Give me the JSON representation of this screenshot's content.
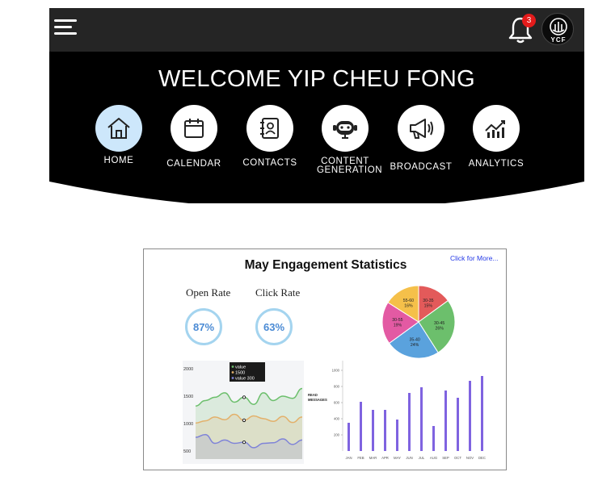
{
  "header": {
    "notification_count": "3",
    "logo_text": "YCF"
  },
  "hero": {
    "welcome": "WELCOME YIP CHEU FONG"
  },
  "nav": [
    {
      "label": "HOME",
      "icon": "home-icon",
      "active": true
    },
    {
      "label": "CALENDAR",
      "icon": "calendar-icon"
    },
    {
      "label": "CONTACTS",
      "icon": "contacts-icon"
    },
    {
      "label": "CONTENT GENERATION",
      "icon": "robot-icon"
    },
    {
      "label": "BROADCAST",
      "icon": "megaphone-icon"
    },
    {
      "label": "ANALYTICS",
      "icon": "analytics-icon"
    }
  ],
  "stats": {
    "title": "May Engagement Statistics",
    "link": "Click for More...",
    "open_rate_label": "Open Rate",
    "open_rate": "87%",
    "click_rate_label": "Click Rate",
    "click_rate": "63%"
  },
  "chart_data": [
    {
      "type": "pie",
      "slices": [
        {
          "label": "30-35",
          "value": 15,
          "display": "30-35\n15%",
          "color": "#e35a5a"
        },
        {
          "label": "30-45",
          "value": 26,
          "display": "30-45\n26%",
          "color": "#6cbf6c"
        },
        {
          "label": "35-40",
          "value": 24,
          "display": "35-40\n24%",
          "color": "#5aa2dd"
        },
        {
          "label": "30-55",
          "value": 19,
          "display": "30-55\n19%",
          "color": "#e35aa3"
        },
        {
          "label": "55-60",
          "value": 16,
          "display": "55-60\n16%",
          "color": "#f5c04a"
        }
      ]
    },
    {
      "type": "line",
      "yticks": [
        "2000",
        "1500",
        "1000",
        "500"
      ],
      "ylim": [
        500,
        2000
      ],
      "tooltip": [
        "value",
        "1500",
        "value   300"
      ],
      "series": [
        {
          "color": "#6cbf6c",
          "values": [
            1320,
            1420,
            1480,
            1560,
            1390,
            1480,
            1350,
            1560,
            1420,
            1500,
            1460,
            1640
          ]
        },
        {
          "color": "#e3b06a",
          "values": [
            1010,
            1050,
            1120,
            1070,
            1170,
            1060,
            1140,
            1090,
            1040,
            1130,
            1020,
            1120
          ]
        },
        {
          "color": "#7f83d8",
          "values": [
            750,
            800,
            640,
            700,
            640,
            660,
            560,
            640,
            650,
            720,
            620,
            700
          ]
        }
      ]
    },
    {
      "type": "bar",
      "ylabel": "READ MESSAGES",
      "yticks": [
        "1000",
        "800",
        "600",
        "400",
        "200"
      ],
      "ylim": [
        0,
        1100
      ],
      "categories": [
        "JAN",
        "FEB",
        "MAR",
        "APR",
        "MAY",
        "JUN",
        "JUL",
        "AUG",
        "SEP",
        "OCT",
        "NOV",
        "DEC"
      ],
      "values": [
        350,
        610,
        510,
        510,
        390,
        720,
        790,
        310,
        750,
        660,
        870,
        930
      ],
      "color": "#7f63e0"
    }
  ]
}
